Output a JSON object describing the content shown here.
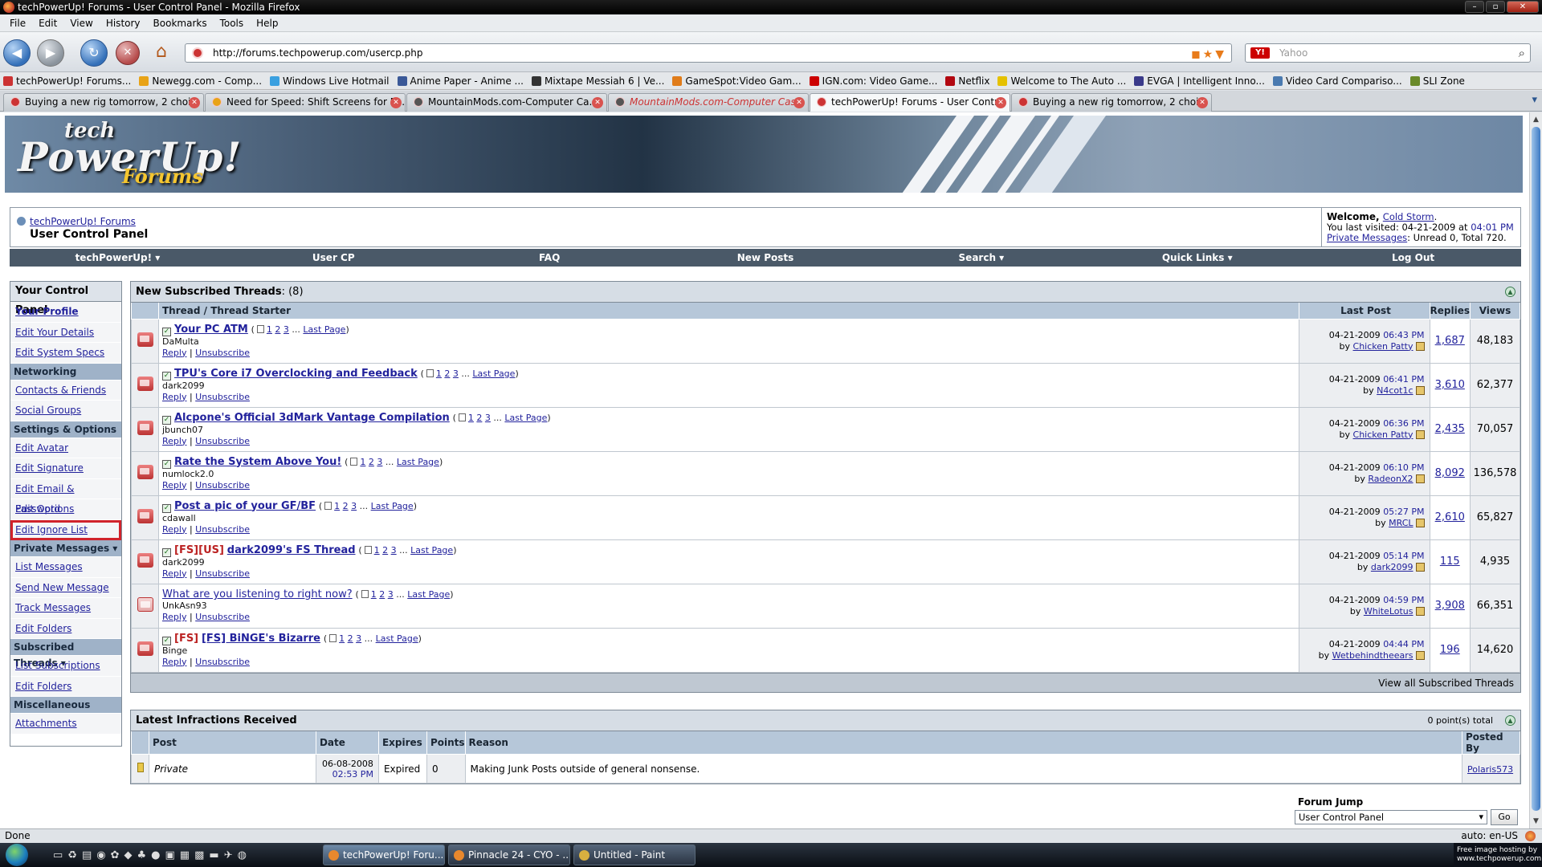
{
  "window": {
    "title": "techPowerUp! Forums - User Control Panel - Mozilla Firefox"
  },
  "menu": [
    "File",
    "Edit",
    "View",
    "History",
    "Bookmarks",
    "Tools",
    "Help"
  ],
  "address": {
    "url": "http://forums.techpowerup.com/usercp.php"
  },
  "search": {
    "placeholder": "Yahoo",
    "engine_label": "Y!"
  },
  "bookmarks": [
    "techPowerUp! Forums...",
    "Newegg.com - Comp...",
    "Windows Live Hotmail",
    "Anime Paper - Anime ...",
    "Mixtape Messiah 6 | Ve...",
    "GameSpot:Video Gam...",
    "IGN.com: Video Game...",
    "Netflix",
    "Welcome to The Auto ...",
    "EVGA | Intelligent Inno...",
    "Video Card Compariso...",
    "SLI Zone"
  ],
  "tabs": [
    {
      "label": "Buying a new rig tomorrow, 2 choi...",
      "active": false
    },
    {
      "label": "Need for Speed: Shift Screens for PI...",
      "active": false
    },
    {
      "label": "MountainMods.com-Computer Ca...",
      "active": false
    },
    {
      "label": "MountainMods.com-Computer Cas...",
      "active": false
    },
    {
      "label": "techPowerUp! Forums - User Contr...",
      "active": true
    },
    {
      "label": "Buying a new rig tomorrow, 2 choi...",
      "active": false
    }
  ],
  "logo": {
    "l1": "tech",
    "l2": "PowerUp!",
    "l3": "Forums"
  },
  "breadcrumb": {
    "home": "techPowerUp! Forums",
    "current": "User Control Panel"
  },
  "welcome": {
    "label": "Welcome, ",
    "user": "Cold Storm",
    "visited_label": "You last visited: 04-21-2009 at ",
    "visited_time": "04:01 PM",
    "pm_link": "Private Messages",
    "pm_text": ": Unread 0, Total 720."
  },
  "topnav": [
    "techPowerUp! ▾",
    "User CP",
    "FAQ",
    "New Posts",
    "Search ▾",
    "Quick Links ▾",
    "Log Out"
  ],
  "sidebar": {
    "title": "Your Control Panel",
    "profile": "Your Profile",
    "profile_items": [
      "Edit Your Details",
      "Edit System Specs"
    ],
    "networking": "Networking",
    "networking_items": [
      "Contacts & Friends",
      "Social Groups"
    ],
    "settings": "Settings & Options",
    "settings_items": [
      "Edit Avatar",
      "Edit Signature",
      "Edit Email & Password",
      "Edit Options",
      "Edit Ignore List"
    ],
    "pm": "Private Messages ▾",
    "pm_items": [
      "List Messages",
      "Send New Message",
      "Track Messages",
      "Edit Folders"
    ],
    "subs": "Subscribed Threads ▾",
    "subs_items": [
      "List Subscriptions",
      "Edit Folders"
    ],
    "misc": "Miscellaneous",
    "misc_items": [
      "Attachments"
    ]
  },
  "subscribed": {
    "title": "New Subscribed Threads",
    "count": ": (8)",
    "col_thread": "Thread / Thread Starter",
    "col_last": "Last Post",
    "col_replies": "Replies",
    "col_views": "Views",
    "footer": "View all Subscribed Threads",
    "pages": [
      "1",
      "2",
      "3"
    ],
    "last_page": "Last Page",
    "reply": "Reply",
    "unsubscribe": "Unsubscribe",
    "by": "by ",
    "threads": [
      {
        "prefix": "",
        "title": "Your PC ATM",
        "bold": true,
        "starter": "DaMulta",
        "date": "04-21-2009",
        "time": "06:43 PM",
        "poster": "Chicken Patty",
        "replies": "1,687",
        "views": "48,183"
      },
      {
        "prefix": "",
        "title": "TPU's Core i7 Overclocking and Feedback",
        "bold": true,
        "starter": "dark2099",
        "date": "04-21-2009",
        "time": "06:41 PM",
        "poster": "N4cot1c",
        "replies": "3,610",
        "views": "62,377"
      },
      {
        "prefix": "",
        "title": "Alcpone's Official 3dMark Vantage Compilation",
        "bold": true,
        "starter": "jbunch07",
        "date": "04-21-2009",
        "time": "06:36 PM",
        "poster": "Chicken Patty",
        "replies": "2,435",
        "views": "70,057"
      },
      {
        "prefix": "",
        "title": "Rate the System Above You!",
        "bold": true,
        "starter": "numlock2.0",
        "date": "04-21-2009",
        "time": "06:10 PM",
        "poster": "RadeonX2",
        "replies": "8,092",
        "views": "136,578"
      },
      {
        "prefix": "",
        "title": "Post a pic of your GF/BF",
        "bold": true,
        "starter": "cdawall",
        "date": "04-21-2009",
        "time": "05:27 PM",
        "poster": "MRCL",
        "replies": "2,610",
        "views": "65,827"
      },
      {
        "prefix": "[FS][US]",
        "title": "dark2099's FS Thread",
        "bold": true,
        "starter": "dark2099",
        "date": "04-21-2009",
        "time": "05:14 PM",
        "poster": "dark2099",
        "replies": "115",
        "views": "4,935"
      },
      {
        "prefix": "",
        "title": "What are you listening to right now?",
        "bold": false,
        "starter": "UnkAsn93",
        "date": "04-21-2009",
        "time": "04:59 PM",
        "poster": "WhiteLotus",
        "replies": "3,908",
        "views": "66,351"
      },
      {
        "prefix": "[FS]",
        "title": "[FS] BiNGE's Bizarre",
        "bold": true,
        "starter": "Binge",
        "date": "04-21-2009",
        "time": "04:44 PM",
        "poster": "Wetbehindtheears",
        "replies": "196",
        "views": "14,620"
      }
    ]
  },
  "infractions": {
    "title": "Latest Infractions Received",
    "total": "0 point(s) total",
    "cols": [
      "Post",
      "Date",
      "Expires",
      "Points",
      "Reason",
      "Posted By"
    ],
    "row": {
      "post": "Private",
      "date": "06-08-2008",
      "time": "02:53 PM",
      "expires": "Expired",
      "points": "0",
      "reason": "Making Junk Posts outside of general nonsense.",
      "by": "Polaris573"
    }
  },
  "forum_jump": {
    "label": "Forum Jump",
    "selected": "User Control Panel",
    "go": "Go"
  },
  "status": {
    "left": "Done",
    "right": "auto: en-US"
  },
  "taskbar": {
    "tasks": [
      "techPowerUp! Foru...",
      "Pinnacle 24 - CYO - ...",
      "Untitled - Paint"
    ],
    "tray": "Free image hosting by www.techpowerup.com"
  }
}
